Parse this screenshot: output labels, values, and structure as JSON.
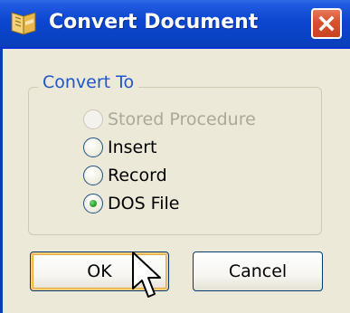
{
  "window": {
    "title": "Convert Document",
    "title_icon": "document-convert-icon",
    "close_icon": "close-icon"
  },
  "group": {
    "label": "Convert To",
    "options": [
      {
        "label": "Stored Procedure",
        "enabled": false,
        "selected": false
      },
      {
        "label": "Insert",
        "enabled": true,
        "selected": false
      },
      {
        "label": "Record",
        "enabled": true,
        "selected": false
      },
      {
        "label": "DOS File",
        "enabled": true,
        "selected": true
      }
    ]
  },
  "buttons": {
    "ok_label": "OK",
    "cancel_label": "Cancel"
  },
  "colors": {
    "titlebar": "#0b47cf",
    "dialog_bg": "#ece9d8",
    "group_label": "#1e56c8",
    "disabled_text": "#aca899",
    "close_button": "#d9502e"
  },
  "cursor": "arrow-pointer-icon"
}
